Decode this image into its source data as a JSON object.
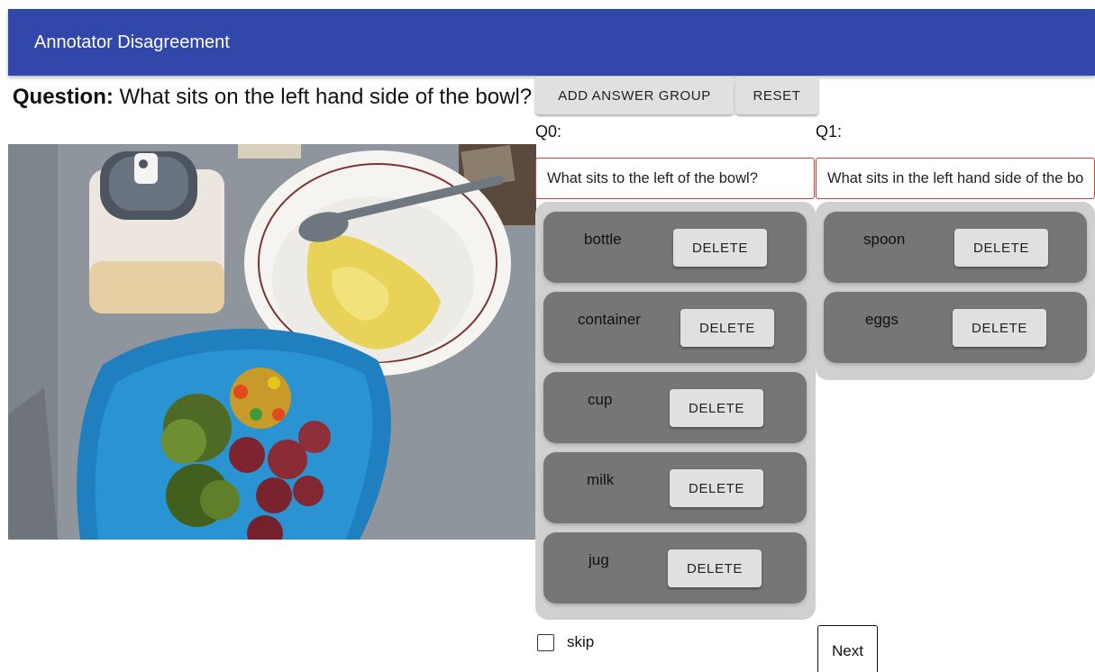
{
  "appbar": {
    "title": "Annotator Disagreement"
  },
  "question": {
    "prefix": "Question:",
    "text": "What sits on the left hand side of the bowl?"
  },
  "toolbar": {
    "add_group_label": "ADD ANSWER GROUP",
    "reset_label": "RESET"
  },
  "groups": [
    {
      "label": "Q0:",
      "question_value": "What sits to the left of the bowl?",
      "answers": [
        {
          "text": "bottle",
          "delete_label": "DELETE"
        },
        {
          "text": "container",
          "delete_label": "DELETE"
        },
        {
          "text": "cup",
          "delete_label": "DELETE"
        },
        {
          "text": "milk",
          "delete_label": "DELETE"
        },
        {
          "text": "jug",
          "delete_label": "DELETE"
        }
      ]
    },
    {
      "label": "Q1:",
      "question_value": "What sits in the left hand side of the bowl?",
      "answers": [
        {
          "text": "spoon",
          "delete_label": "DELETE"
        },
        {
          "text": "eggs",
          "delete_label": "DELETE"
        }
      ]
    }
  ],
  "footer": {
    "skip_label": "skip",
    "next_label": "Next"
  },
  "colors": {
    "appbar": "#3148aa",
    "input_border": "#d93b3b",
    "answer_bg": "#767676",
    "group_bg": "#d0d0d0"
  }
}
